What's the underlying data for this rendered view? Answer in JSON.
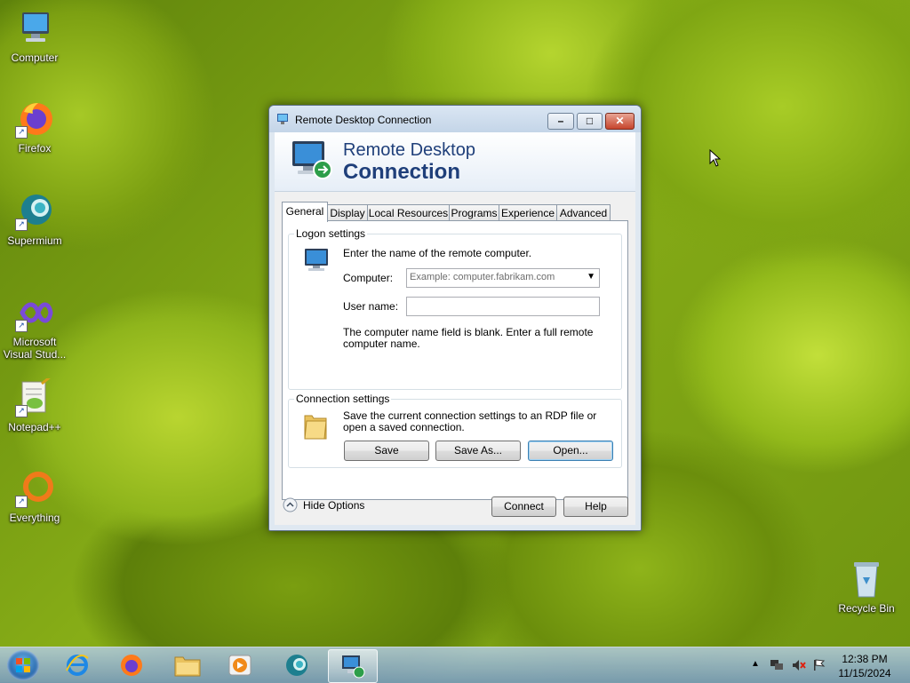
{
  "desktop": {
    "icons": [
      {
        "label": "Computer"
      },
      {
        "label": "Firefox"
      },
      {
        "label": "Supermium"
      },
      {
        "label": "Microsoft Visual Stud..."
      },
      {
        "label": "Notepad++"
      },
      {
        "label": "Everything"
      },
      {
        "label": "Recycle Bin"
      }
    ]
  },
  "window": {
    "title": "Remote Desktop Connection",
    "banner_line1": "Remote Desktop",
    "banner_line2": "Connection",
    "tabs": [
      {
        "label": "General",
        "active": true
      },
      {
        "label": "Display"
      },
      {
        "label": "Local Resources"
      },
      {
        "label": "Programs"
      },
      {
        "label": "Experience"
      },
      {
        "label": "Advanced"
      }
    ],
    "logon": {
      "legend": "Logon settings",
      "instruction": "Enter the name of the remote computer.",
      "computer_label": "Computer:",
      "computer_placeholder": "Example: computer.fabrikam.com",
      "username_label": "User name:",
      "username_value": "",
      "note": "The computer name field is blank. Enter a full remote computer name."
    },
    "connection": {
      "legend": "Connection settings",
      "description": "Save the current connection settings to an RDP file or open a saved connection.",
      "save_label": "Save",
      "save_as_label": "Save As...",
      "open_label": "Open..."
    },
    "hide_options_label": "Hide Options",
    "connect_label": "Connect",
    "help_label": "Help"
  },
  "taskbar": {
    "time": "12:38 PM",
    "date": "11/15/2024"
  },
  "colors": {
    "banner_text": "#1f3f7a",
    "focus_border": "#3c7fb1"
  }
}
